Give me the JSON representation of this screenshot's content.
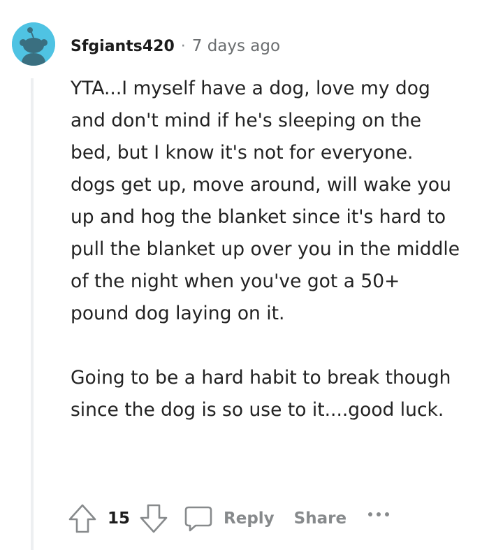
{
  "comment": {
    "username": "Sfgiants420",
    "separator": "·",
    "timestamp": "7 days ago",
    "paragraphs": [
      "YTA...I myself have a dog, love my dog and don't mind if he's sleeping on the bed, but I know it's not for everyone. dogs get up, move around, will wake you up and hog the blanket since it's hard to pull the blanket up over you in the middle of the night when you've got a 50+ pound dog laying on it.",
      "Going to be a hard habit to break though since the dog is so use to it....good luck."
    ]
  },
  "actions": {
    "score": "15",
    "reply_label": "Reply",
    "share_label": "Share",
    "icons": {
      "upvote": "upvote-arrow-icon",
      "downvote": "downvote-arrow-icon",
      "comment": "comment-bubble-icon",
      "more": "more-options-icon"
    }
  },
  "colors": {
    "avatar_bg": "#4fc3e3",
    "muted_text": "#878a8c",
    "thread_line": "#edeff1"
  }
}
